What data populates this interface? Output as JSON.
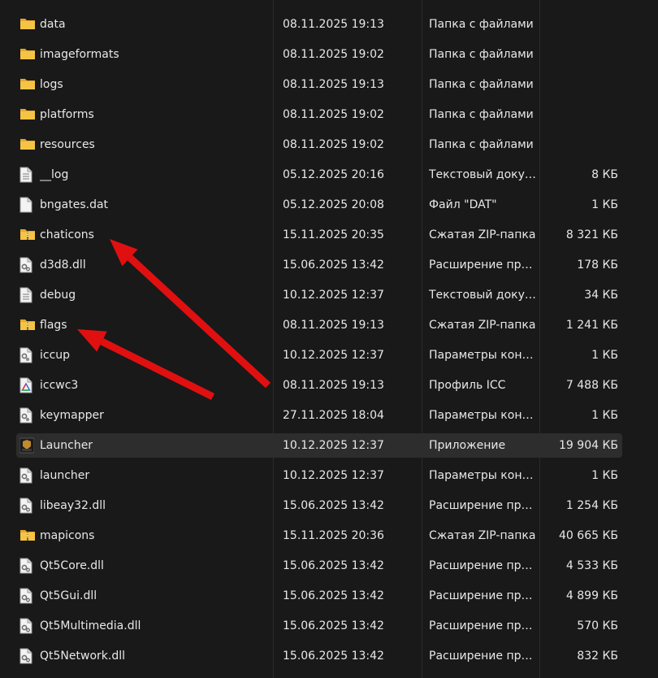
{
  "files": [
    {
      "name": "data",
      "date": "08.11.2025 19:13",
      "type": "Папка с файлами",
      "size": "",
      "icon": "folder-icon"
    },
    {
      "name": "imageformats",
      "date": "08.11.2025 19:02",
      "type": "Папка с файлами",
      "size": "",
      "icon": "folder-icon"
    },
    {
      "name": "logs",
      "date": "08.11.2025 19:13",
      "type": "Папка с файлами",
      "size": "",
      "icon": "folder-icon"
    },
    {
      "name": "platforms",
      "date": "08.11.2025 19:02",
      "type": "Папка с файлами",
      "size": "",
      "icon": "folder-icon"
    },
    {
      "name": "resources",
      "date": "08.11.2025 19:02",
      "type": "Папка с файлами",
      "size": "",
      "icon": "folder-icon"
    },
    {
      "name": "__log",
      "date": "05.12.2025 20:16",
      "type": "Текстовый документ",
      "size": "8 КБ",
      "icon": "text-file-icon"
    },
    {
      "name": "bngates.dat",
      "date": "05.12.2025 20:08",
      "type": "Файл \"DAT\"",
      "size": "1 КБ",
      "icon": "blank-file-icon"
    },
    {
      "name": "chaticons",
      "date": "15.11.2025 20:35",
      "type": "Сжатая ZIP-папка",
      "size": "8 321 КБ",
      "icon": "zip-folder-icon"
    },
    {
      "name": "d3d8.dll",
      "date": "15.06.2025 13:42",
      "type": "Расширение приложения",
      "size": "178 КБ",
      "icon": "dll-file-icon"
    },
    {
      "name": "debug",
      "date": "10.12.2025 12:37",
      "type": "Текстовый документ",
      "size": "34 КБ",
      "icon": "text-file-icon"
    },
    {
      "name": "flags",
      "date": "08.11.2025 19:13",
      "type": "Сжатая ZIP-папка",
      "size": "1 241 КБ",
      "icon": "zip-folder-icon"
    },
    {
      "name": "iccup",
      "date": "10.12.2025 12:37",
      "type": "Параметры конфигурации",
      "size": "1 КБ",
      "icon": "config-file-icon"
    },
    {
      "name": "iccwc3",
      "date": "08.11.2025 19:13",
      "type": "Профиль ICC",
      "size": "7 488 КБ",
      "icon": "icc-profile-icon"
    },
    {
      "name": "keymapper",
      "date": "27.11.2025 18:04",
      "type": "Параметры конфигурации",
      "size": "1 КБ",
      "icon": "config-file-icon"
    },
    {
      "name": "Launcher",
      "date": "10.12.2025 12:37",
      "type": "Приложение",
      "size": "19 904 КБ",
      "icon": "launcher-app-icon",
      "selected": true
    },
    {
      "name": "launcher",
      "date": "10.12.2025 12:37",
      "type": "Параметры конфигурации",
      "size": "1 КБ",
      "icon": "config-file-icon"
    },
    {
      "name": "libeay32.dll",
      "date": "15.06.2025 13:42",
      "type": "Расширение приложения",
      "size": "1 254 КБ",
      "icon": "dll-file-icon"
    },
    {
      "name": "mapicons",
      "date": "15.11.2025 20:36",
      "type": "Сжатая ZIP-папка",
      "size": "40 665 КБ",
      "icon": "zip-folder-icon"
    },
    {
      "name": "Qt5Core.dll",
      "date": "15.06.2025 13:42",
      "type": "Расширение приложения",
      "size": "4 533 КБ",
      "icon": "dll-file-icon"
    },
    {
      "name": "Qt5Gui.dll",
      "date": "15.06.2025 13:42",
      "type": "Расширение приложения",
      "size": "4 899 КБ",
      "icon": "dll-file-icon"
    },
    {
      "name": "Qt5Multimedia.dll",
      "date": "15.06.2025 13:42",
      "type": "Расширение приложения",
      "size": "570 КБ",
      "icon": "dll-file-icon"
    },
    {
      "name": "Qt5Network.dll",
      "date": "15.06.2025 13:42",
      "type": "Расширение приложения",
      "size": "832 КБ",
      "icon": "dll-file-icon"
    }
  ],
  "annotations": {
    "arrow_color": "#e01010",
    "targets": [
      "chaticons",
      "flags"
    ]
  },
  "colors": {
    "background": "#191919",
    "selected_row": "#2d2d2d",
    "folder": "#f6c445",
    "text": "#e8e8e8"
  }
}
